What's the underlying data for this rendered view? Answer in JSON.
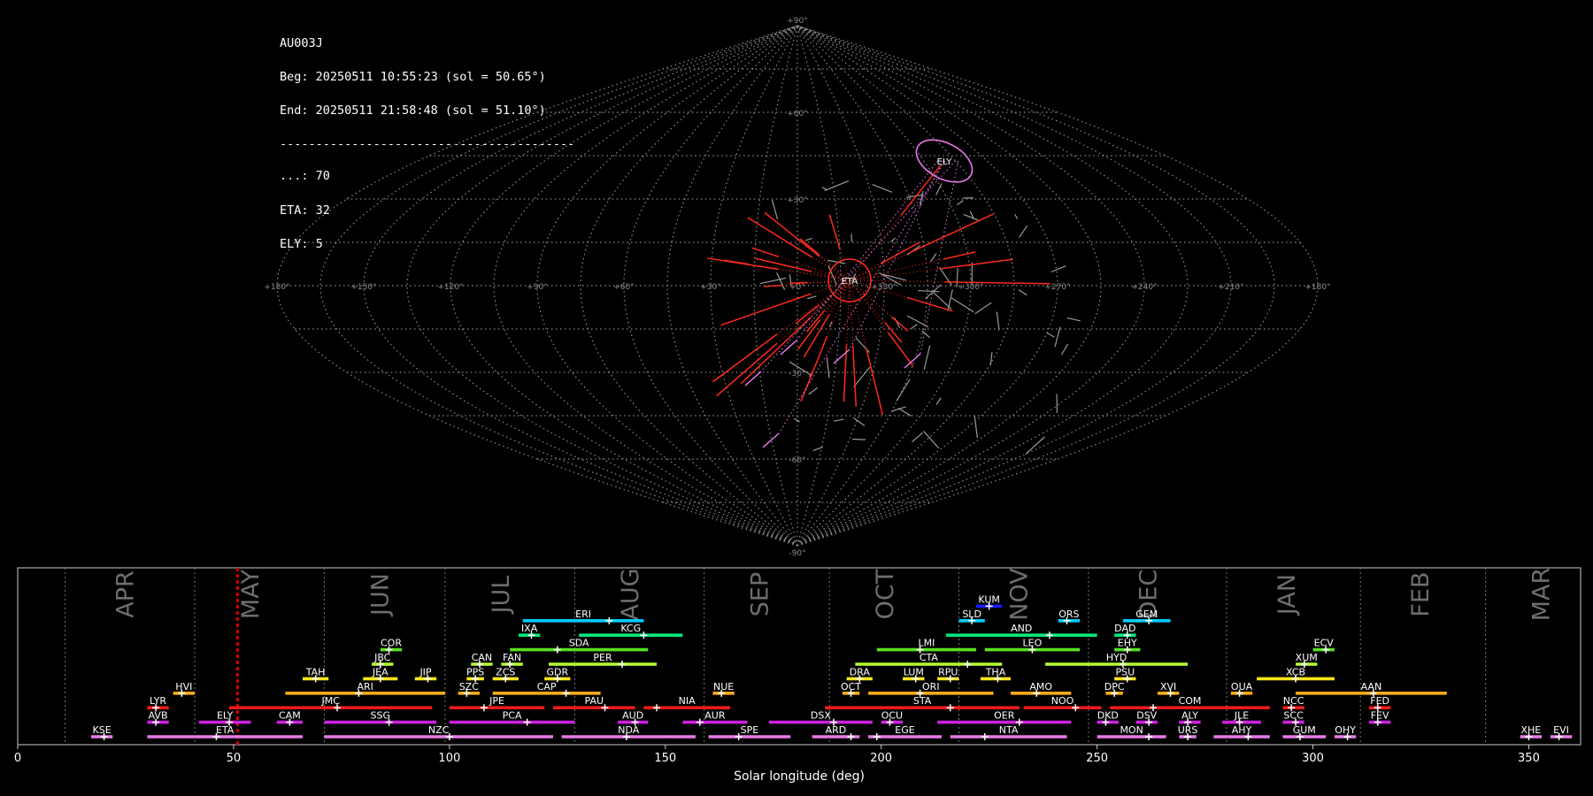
{
  "stats": {
    "station": "AU003J",
    "beg": "Beg: 20250511 10:55:23 (sol = 50.65°)",
    "end": "End: 20250511 21:58:48 (sol = 51.10°)",
    "separator": "-----------------------------------------",
    "counts": [
      {
        "label": "...",
        "value": 70
      },
      {
        "label": "ETA",
        "value": 32
      },
      {
        "label": "ELY",
        "value": 5
      }
    ]
  },
  "chart_data": [
    {
      "type": "scatter",
      "projection": "sinusoidal",
      "lon_tick_labels": [
        "+180°",
        "+150°",
        "+120°",
        "+90°",
        "+60°",
        "+30°",
        "+0°",
        "+330°",
        "+300°",
        "+270°",
        "+240°",
        "+210°",
        "+180°"
      ],
      "lat_tick_labels": [
        "+90°",
        "+60°",
        "+30°",
        "-30°",
        "-60°",
        "-90°"
      ],
      "radiants": [
        {
          "name": "ETA",
          "color": "#ff2a1a"
        },
        {
          "name": "ELY",
          "color": "#e878e8"
        }
      ]
    },
    {
      "type": "timeline",
      "xlabel": "Solar longitude (deg)",
      "xlim": [
        0,
        362
      ],
      "x_ticks": [
        0,
        50,
        100,
        150,
        200,
        250,
        300,
        350
      ],
      "current_sol": 50.9,
      "months": [
        {
          "name": "APR",
          "start": 11,
          "center": 25
        },
        {
          "name": "MAY",
          "start": 41,
          "center": 54
        },
        {
          "name": "JUN",
          "start": 71,
          "center": 84
        },
        {
          "name": "JUL",
          "start": 99,
          "center": 112
        },
        {
          "name": "AUG",
          "start": 129,
          "center": 142
        },
        {
          "name": "SEP",
          "start": 159,
          "center": 172
        },
        {
          "name": "OCT",
          "start": 188,
          "center": 201
        },
        {
          "name": "NOV",
          "start": 218,
          "center": 232
        },
        {
          "name": "DEC",
          "start": 248,
          "center": 262
        },
        {
          "name": "JAN",
          "start": 280,
          "center": 294
        },
        {
          "name": "FEB",
          "start": 311,
          "center": 325
        },
        {
          "name": "MAR",
          "start": 340,
          "center": 353
        }
      ],
      "showers": [
        {
          "code": "KUM",
          "row": 9,
          "start": 222,
          "end": 228,
          "peak": 225,
          "color": "#1a1aff"
        },
        {
          "code": "ERI",
          "row": 8,
          "start": 117,
          "end": 145,
          "peak": 137,
          "color": "#00ccff"
        },
        {
          "code": "SLD",
          "row": 8,
          "start": 218,
          "end": 224,
          "peak": 221,
          "color": "#00ccff"
        },
        {
          "code": "ORS",
          "row": 8,
          "start": 241,
          "end": 246,
          "peak": 243,
          "color": "#00ccff"
        },
        {
          "code": "GEM",
          "row": 8,
          "start": 256,
          "end": 267,
          "peak": 262,
          "color": "#00ccff"
        },
        {
          "code": "IXA",
          "row": 7,
          "start": 116,
          "end": 121,
          "peak": 119,
          "color": "#00e87a"
        },
        {
          "code": "KCG",
          "row": 7,
          "start": 130,
          "end": 154,
          "peak": 145,
          "color": "#00e87a"
        },
        {
          "code": "AND",
          "row": 7,
          "start": 215,
          "end": 250,
          "peak": 239,
          "color": "#00e87a"
        },
        {
          "code": "DAD",
          "row": 7,
          "start": 254,
          "end": 259,
          "peak": 257,
          "color": "#00e87a"
        },
        {
          "code": "COR",
          "row": 6,
          "start": 84,
          "end": 89,
          "peak": 86,
          "color": "#55e022"
        },
        {
          "code": "SDA",
          "row": 6,
          "start": 114,
          "end": 146,
          "peak": 125,
          "color": "#55e022"
        },
        {
          "code": "LMI",
          "row": 6,
          "start": 199,
          "end": 222,
          "peak": 209,
          "color": "#55e022"
        },
        {
          "code": "LEO",
          "row": 6,
          "start": 224,
          "end": 246,
          "peak": 235,
          "color": "#55e022"
        },
        {
          "code": "EHY",
          "row": 6,
          "start": 254,
          "end": 260,
          "peak": 257,
          "color": "#55e022"
        },
        {
          "code": "ECV",
          "row": 6,
          "start": 300,
          "end": 305,
          "peak": 303,
          "color": "#55e022"
        },
        {
          "code": "JBC",
          "row": 5,
          "start": 82,
          "end": 87,
          "peak": 84,
          "color": "#b3ff33"
        },
        {
          "code": "CAN",
          "row": 5,
          "start": 105,
          "end": 110,
          "peak": 107,
          "color": "#b3ff33"
        },
        {
          "code": "FAN",
          "row": 5,
          "start": 112,
          "end": 117,
          "peak": 114,
          "color": "#b3ff33"
        },
        {
          "code": "PER",
          "row": 5,
          "start": 123,
          "end": 148,
          "peak": 140,
          "color": "#b3ff33"
        },
        {
          "code": "CTA",
          "row": 5,
          "start": 194,
          "end": 228,
          "peak": 220,
          "color": "#b3ff33"
        },
        {
          "code": "HYD",
          "row": 5,
          "start": 238,
          "end": 271,
          "peak": 256,
          "color": "#b3ff33"
        },
        {
          "code": "XUM",
          "row": 5,
          "start": 296,
          "end": 301,
          "peak": 298,
          "color": "#b3ff33"
        },
        {
          "code": "TAH",
          "row": 4,
          "start": 66,
          "end": 72,
          "peak": 69,
          "color": "#ffe61a"
        },
        {
          "code": "JEA",
          "row": 4,
          "start": 80,
          "end": 88,
          "peak": 84,
          "color": "#ffe61a"
        },
        {
          "code": "JIP",
          "row": 4,
          "start": 92,
          "end": 97,
          "peak": 95,
          "color": "#ffe61a"
        },
        {
          "code": "PPS",
          "row": 4,
          "start": 104,
          "end": 108,
          "peak": 106,
          "color": "#ffe61a"
        },
        {
          "code": "ZCS",
          "row": 4,
          "start": 110,
          "end": 116,
          "peak": 113,
          "color": "#ffe61a"
        },
        {
          "code": "GDR",
          "row": 4,
          "start": 122,
          "end": 128,
          "peak": 125,
          "color": "#ffe61a"
        },
        {
          "code": "DRA",
          "row": 4,
          "start": 192,
          "end": 198,
          "peak": 195,
          "color": "#ffe61a"
        },
        {
          "code": "LUM",
          "row": 4,
          "start": 205,
          "end": 210,
          "peak": 208,
          "color": "#ffe61a"
        },
        {
          "code": "RPU",
          "row": 4,
          "start": 213,
          "end": 218,
          "peak": 216,
          "color": "#ffe61a"
        },
        {
          "code": "THA",
          "row": 4,
          "start": 223,
          "end": 230,
          "peak": 227,
          "color": "#ffe61a"
        },
        {
          "code": "PSU",
          "row": 4,
          "start": 254,
          "end": 259,
          "peak": 257,
          "color": "#ffe61a"
        },
        {
          "code": "XCB",
          "row": 4,
          "start": 287,
          "end": 305,
          "peak": 296,
          "color": "#ffe61a"
        },
        {
          "code": "HVI",
          "row": 3,
          "start": 36,
          "end": 41,
          "peak": 38,
          "color": "#ffaa1a"
        },
        {
          "code": "ARI",
          "row": 3,
          "start": 62,
          "end": 99,
          "peak": 79,
          "color": "#ffaa1a"
        },
        {
          "code": "SZC",
          "row": 3,
          "start": 102,
          "end": 107,
          "peak": 104,
          "color": "#ffaa1a"
        },
        {
          "code": "CAP",
          "row": 3,
          "start": 110,
          "end": 135,
          "peak": 127,
          "color": "#ffaa1a"
        },
        {
          "code": "NUE",
          "row": 3,
          "start": 161,
          "end": 166,
          "peak": 163,
          "color": "#ffaa1a"
        },
        {
          "code": "OCT",
          "row": 3,
          "start": 191,
          "end": 195,
          "peak": 193,
          "color": "#ffaa1a"
        },
        {
          "code": "ORI",
          "row": 3,
          "start": 197,
          "end": 226,
          "peak": 209,
          "color": "#ffaa1a"
        },
        {
          "code": "AMO",
          "row": 3,
          "start": 230,
          "end": 244,
          "peak": 236,
          "color": "#ffaa1a"
        },
        {
          "code": "DPC",
          "row": 3,
          "start": 252,
          "end": 256,
          "peak": 254,
          "color": "#ffaa1a"
        },
        {
          "code": "XVI",
          "row": 3,
          "start": 264,
          "end": 269,
          "peak": 267,
          "color": "#ffaa1a"
        },
        {
          "code": "OUA",
          "row": 3,
          "start": 281,
          "end": 286,
          "peak": 283,
          "color": "#ffaa1a"
        },
        {
          "code": "AAN",
          "row": 3,
          "start": 296,
          "end": 331,
          "peak": 314,
          "color": "#ffaa1a"
        },
        {
          "code": "LYR",
          "row": 2,
          "start": 30,
          "end": 35,
          "peak": 32,
          "color": "#ee1a1a"
        },
        {
          "code": "JMC",
          "row": 2,
          "start": 49,
          "end": 96,
          "peak": 74,
          "color": "#ee1a1a"
        },
        {
          "code": "JPE",
          "row": 2,
          "start": 100,
          "end": 122,
          "peak": 108,
          "color": "#ee1a1a"
        },
        {
          "code": "PAU",
          "row": 2,
          "start": 124,
          "end": 143,
          "peak": 136,
          "color": "#ee1a1a"
        },
        {
          "code": "NIA",
          "row": 2,
          "start": 145,
          "end": 165,
          "peak": 148,
          "color": "#ee1a1a"
        },
        {
          "code": "STA",
          "row": 2,
          "start": 187,
          "end": 232,
          "peak": 216,
          "color": "#ee1a1a"
        },
        {
          "code": "NOO",
          "row": 2,
          "start": 233,
          "end": 251,
          "peak": 245,
          "color": "#ee1a1a"
        },
        {
          "code": "COM",
          "row": 2,
          "start": 253,
          "end": 290,
          "peak": 263,
          "color": "#ee1a1a"
        },
        {
          "code": "NCC",
          "row": 2,
          "start": 293,
          "end": 298,
          "peak": 295,
          "color": "#ee1a1a"
        },
        {
          "code": "FED",
          "row": 2,
          "start": 313,
          "end": 318,
          "peak": 315,
          "color": "#ee1a1a"
        },
        {
          "code": "AVB",
          "row": 1,
          "start": 30,
          "end": 35,
          "peak": 32,
          "color": "#cc22dd"
        },
        {
          "code": "ELY",
          "row": 1,
          "start": 42,
          "end": 54,
          "peak": 49,
          "color": "#cc22dd"
        },
        {
          "code": "CAM",
          "row": 1,
          "start": 60,
          "end": 66,
          "peak": 63,
          "color": "#cc22dd"
        },
        {
          "code": "SSG",
          "row": 1,
          "start": 71,
          "end": 97,
          "peak": 86,
          "color": "#cc22dd"
        },
        {
          "code": "PCA",
          "row": 1,
          "start": 100,
          "end": 129,
          "peak": 118,
          "color": "#cc22dd"
        },
        {
          "code": "AUD",
          "row": 1,
          "start": 139,
          "end": 146,
          "peak": 143,
          "color": "#cc22dd"
        },
        {
          "code": "AUR",
          "row": 1,
          "start": 154,
          "end": 169,
          "peak": 158,
          "color": "#cc22dd"
        },
        {
          "code": "DSX",
          "row": 1,
          "start": 174,
          "end": 198,
          "peak": 189,
          "color": "#cc22dd"
        },
        {
          "code": "OCU",
          "row": 1,
          "start": 200,
          "end": 205,
          "peak": 202,
          "color": "#cc22dd"
        },
        {
          "code": "OER",
          "row": 1,
          "start": 213,
          "end": 244,
          "peak": 232,
          "color": "#cc22dd"
        },
        {
          "code": "DKD",
          "row": 1,
          "start": 250,
          "end": 255,
          "peak": 252,
          "color": "#cc22dd"
        },
        {
          "code": "DSV",
          "row": 1,
          "start": 259,
          "end": 264,
          "peak": 262,
          "color": "#cc22dd"
        },
        {
          "code": "ALY",
          "row": 1,
          "start": 269,
          "end": 274,
          "peak": 271,
          "color": "#cc22dd"
        },
        {
          "code": "JLE",
          "row": 1,
          "start": 279,
          "end": 288,
          "peak": 283,
          "color": "#cc22dd"
        },
        {
          "code": "SCC",
          "row": 1,
          "start": 293,
          "end": 298,
          "peak": 296,
          "color": "#cc22dd"
        },
        {
          "code": "FEV",
          "row": 1,
          "start": 313,
          "end": 318,
          "peak": 315,
          "color": "#cc22dd"
        },
        {
          "code": "KSE",
          "row": 0,
          "start": 17,
          "end": 22,
          "peak": 20,
          "color": "#e87ae8"
        },
        {
          "code": "ETA",
          "row": 0,
          "start": 30,
          "end": 66,
          "peak": 46,
          "color": "#e87ae8"
        },
        {
          "code": "NZC",
          "row": 0,
          "start": 71,
          "end": 124,
          "peak": 100,
          "color": "#e87ae8"
        },
        {
          "code": "NDA",
          "row": 0,
          "start": 126,
          "end": 157,
          "peak": 141,
          "color": "#e87ae8"
        },
        {
          "code": "SPE",
          "row": 0,
          "start": 160,
          "end": 179,
          "peak": 167,
          "color": "#e87ae8"
        },
        {
          "code": "ARD",
          "row": 0,
          "start": 184,
          "end": 195,
          "peak": 193,
          "color": "#e87ae8"
        },
        {
          "code": "EGE",
          "row": 0,
          "start": 197,
          "end": 214,
          "peak": 199,
          "color": "#e87ae8"
        },
        {
          "code": "NTA",
          "row": 0,
          "start": 216,
          "end": 243,
          "peak": 224,
          "color": "#e87ae8"
        },
        {
          "code": "MON",
          "row": 0,
          "start": 250,
          "end": 266,
          "peak": 262,
          "color": "#e87ae8"
        },
        {
          "code": "URS",
          "row": 0,
          "start": 269,
          "end": 273,
          "peak": 271,
          "color": "#e87ae8"
        },
        {
          "code": "AHY",
          "row": 0,
          "start": 277,
          "end": 290,
          "peak": 285,
          "color": "#e87ae8"
        },
        {
          "code": "GUM",
          "row": 0,
          "start": 293,
          "end": 303,
          "peak": 297,
          "color": "#e87ae8"
        },
        {
          "code": "OHY",
          "row": 0,
          "start": 305,
          "end": 310,
          "peak": 308,
          "color": "#e87ae8"
        },
        {
          "code": "XHE",
          "row": 0,
          "start": 348,
          "end": 353,
          "peak": 350,
          "color": "#e87ae8"
        },
        {
          "code": "EVI",
          "row": 0,
          "start": 355,
          "end": 360,
          "peak": 357,
          "color": "#e87ae8"
        }
      ]
    }
  ]
}
